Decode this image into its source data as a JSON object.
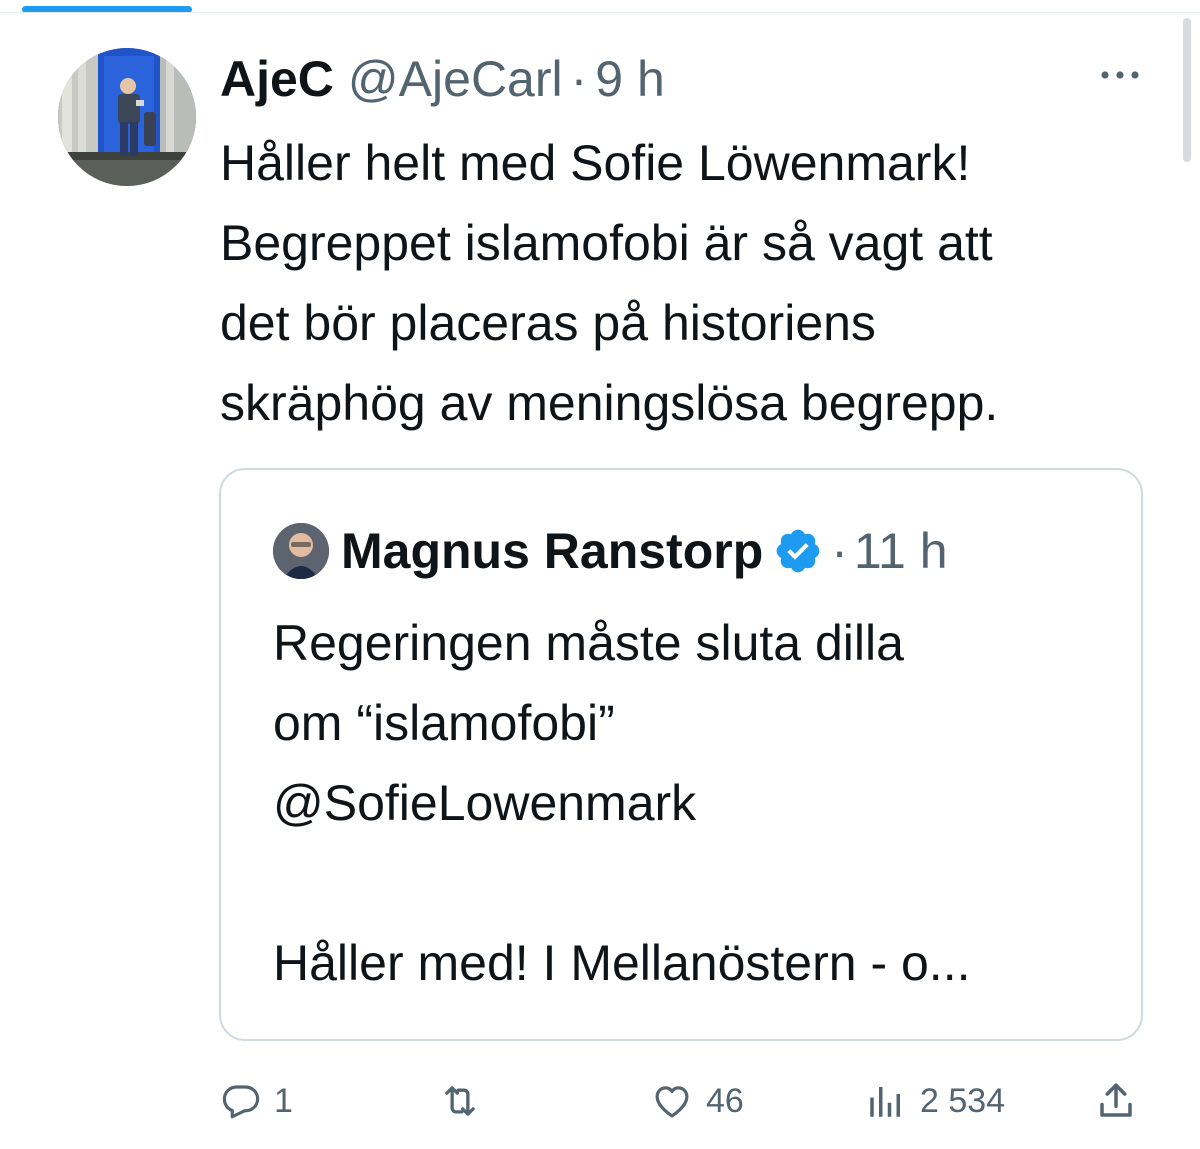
{
  "tweet": {
    "author": {
      "display_name": "AjeC",
      "handle": "@AjeCarl",
      "separator": "·",
      "time": "9 h"
    },
    "text": "Håller helt med Sofie Löwenmark!\nBegreppet islamofobi är så vagt att\ndet bör placeras på historiens\nskräphög av meningslösa begrepp.",
    "more_icon": "ellipsis-icon"
  },
  "quote": {
    "display_name": "Magnus Ranstorp",
    "verified_icon": "verified-badge-icon",
    "separator": "·",
    "time": "11 h",
    "text": "Regeringen måste sluta dilla\nom “islamofobi”\n@SofieLowenmark\n\nHåller med! I Mellanöstern - o..."
  },
  "actions": {
    "reply": {
      "icon": "reply-icon",
      "count": "1"
    },
    "retweet": {
      "icon": "retweet-icon",
      "count": ""
    },
    "like": {
      "icon": "heart-icon",
      "count": "46"
    },
    "views": {
      "icon": "views-icon",
      "count": "2 534"
    },
    "share": {
      "icon": "share-icon",
      "count": ""
    }
  },
  "colors": {
    "accent": "#1d9bf0",
    "text": "#0f1419",
    "secondary_text": "#536471",
    "border": "#cfd9de"
  }
}
